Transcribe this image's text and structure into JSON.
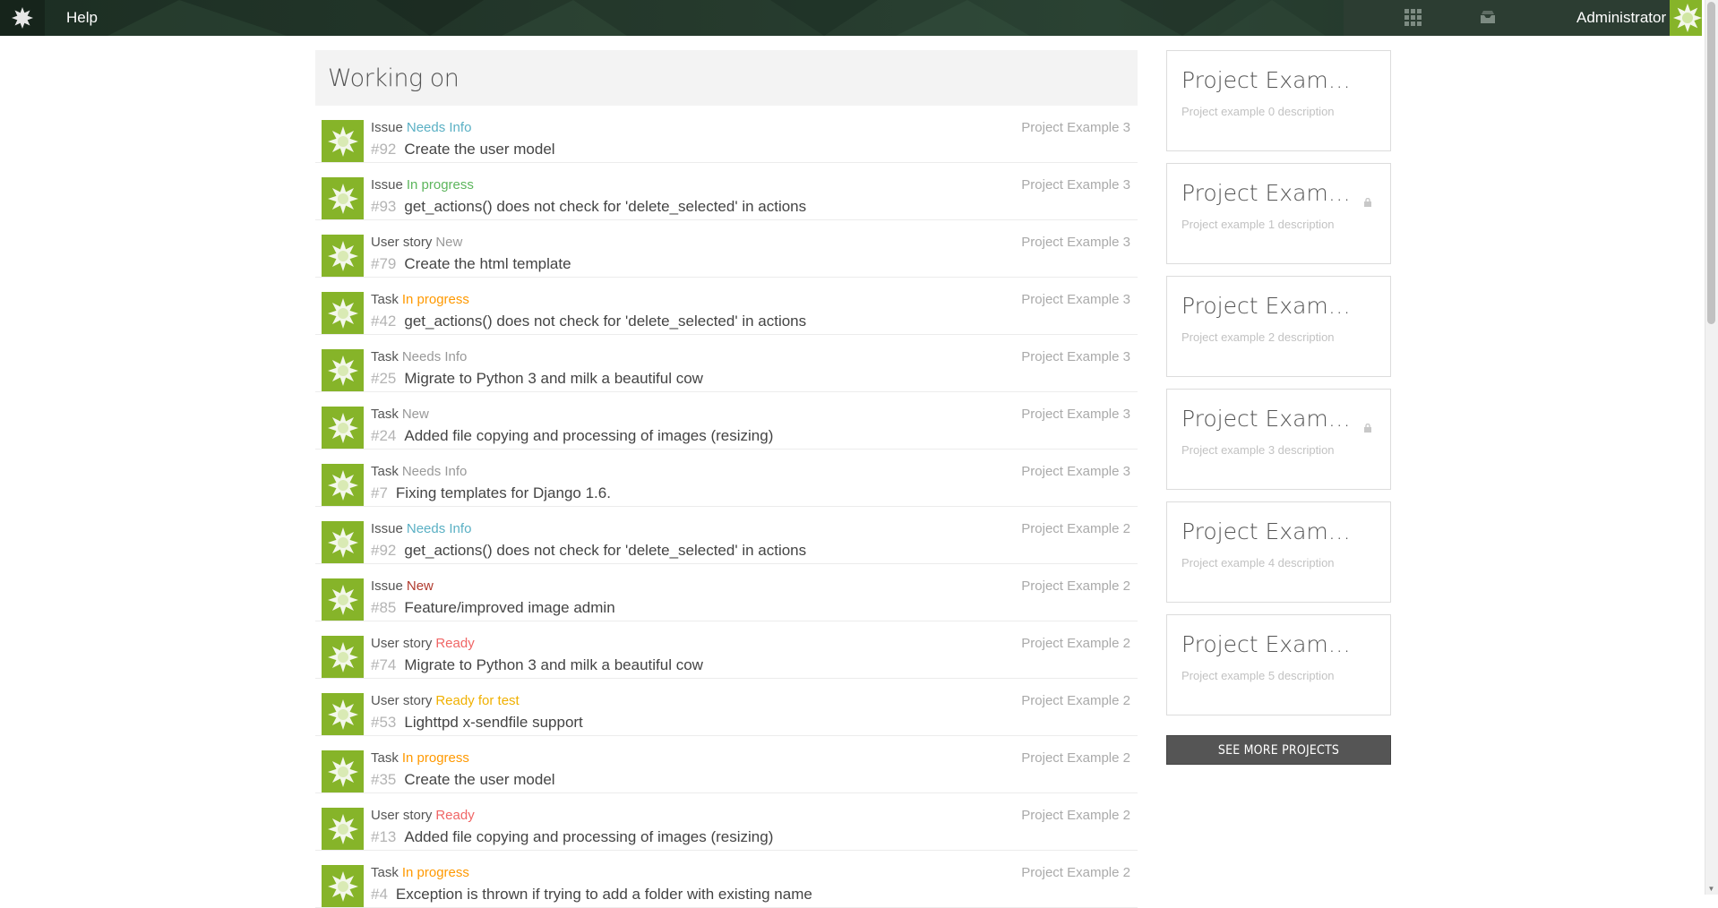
{
  "navbar": {
    "help_label": "Help",
    "username": "Administrator",
    "logo_icon": "taiga-logo-icon",
    "grid_icon": "apps-grid-icon",
    "inbox_icon": "inbox-icon"
  },
  "working_on": {
    "title": "Working on",
    "items": [
      {
        "type": "Issue",
        "status": "Needs Info",
        "status_color": "#5ab0c4",
        "ref": "#92",
        "subject": "Create the user model",
        "project": "Project Example 3"
      },
      {
        "type": "Issue",
        "status": "In progress",
        "status_color": "#5cb55c",
        "ref": "#93",
        "subject": "get_actions() does not check for 'delete_selected' in actions",
        "project": "Project Example 3"
      },
      {
        "type": "User story",
        "status": "New",
        "status_color": "#999999",
        "ref": "#79",
        "subject": "Create the html template",
        "project": "Project Example 3"
      },
      {
        "type": "Task",
        "status": "In progress",
        "status_color": "#ff9900",
        "ref": "#42",
        "subject": "get_actions() does not check for 'delete_selected' in actions",
        "project": "Project Example 3"
      },
      {
        "type": "Task",
        "status": "Needs Info",
        "status_color": "#999999",
        "ref": "#25",
        "subject": "Migrate to Python 3 and milk a beautiful cow",
        "project": "Project Example 3"
      },
      {
        "type": "Task",
        "status": "New",
        "status_color": "#999999",
        "ref": "#24",
        "subject": "Added file copying and processing of images (resizing)",
        "project": "Project Example 3"
      },
      {
        "type": "Task",
        "status": "Needs Info",
        "status_color": "#999999",
        "ref": "#7",
        "subject": "Fixing templates for Django 1.6.",
        "project": "Project Example 3"
      },
      {
        "type": "Issue",
        "status": "Needs Info",
        "status_color": "#5ab0c4",
        "ref": "#92",
        "subject": "get_actions() does not check for 'delete_selected' in actions",
        "project": "Project Example 2"
      },
      {
        "type": "Issue",
        "status": "New",
        "status_color": "#b03a2e",
        "ref": "#85",
        "subject": "Feature/improved image admin",
        "project": "Project Example 2"
      },
      {
        "type": "User story",
        "status": "Ready",
        "status_color": "#f06666",
        "ref": "#74",
        "subject": "Migrate to Python 3 and milk a beautiful cow",
        "project": "Project Example 2"
      },
      {
        "type": "User story",
        "status": "Ready for test",
        "status_color": "#f0b000",
        "ref": "#53",
        "subject": "Lighttpd x-sendfile support",
        "project": "Project Example 2"
      },
      {
        "type": "Task",
        "status": "In progress",
        "status_color": "#ff9900",
        "ref": "#35",
        "subject": "Create the user model",
        "project": "Project Example 2"
      },
      {
        "type": "User story",
        "status": "Ready",
        "status_color": "#f06666",
        "ref": "#13",
        "subject": "Added file copying and processing of images (resizing)",
        "project": "Project Example 2"
      },
      {
        "type": "Task",
        "status": "In progress",
        "status_color": "#ff9900",
        "ref": "#4",
        "subject": "Exception is thrown if trying to add a folder with existing name",
        "project": "Project Example 2"
      }
    ]
  },
  "projects": {
    "cards": [
      {
        "name": "Project Exampl...",
        "description": "Project example 0 description",
        "private": false
      },
      {
        "name": "Project Exampl...",
        "description": "Project example 1 description",
        "private": true
      },
      {
        "name": "Project Exampl...",
        "description": "Project example 2 description",
        "private": false
      },
      {
        "name": "Project Exampl...",
        "description": "Project example 3 description",
        "private": true
      },
      {
        "name": "Project Exampl...",
        "description": "Project example 4 description",
        "private": false
      },
      {
        "name": "Project Exampl...",
        "description": "Project example 5 description",
        "private": false
      }
    ],
    "see_more_label": "SEE MORE PROJECTS"
  }
}
